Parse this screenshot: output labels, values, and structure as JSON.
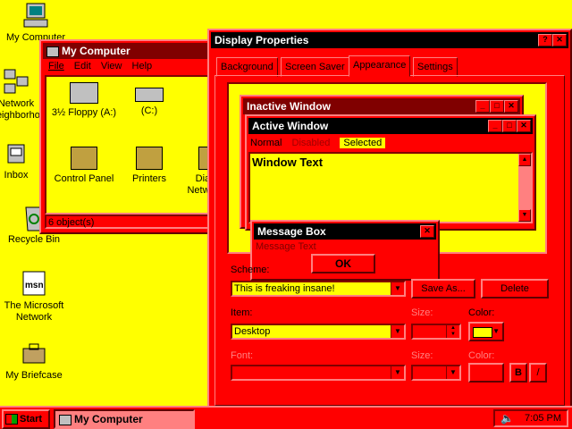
{
  "desktop": {
    "icons": [
      {
        "label": "My Computer"
      },
      {
        "label": "Network Neighborhood"
      },
      {
        "label": "Inbox"
      },
      {
        "label": "Recycle Bin"
      },
      {
        "label": "The Microsoft Network"
      },
      {
        "label": "My Briefcase"
      }
    ]
  },
  "mycomputer": {
    "title": "My Computer",
    "menu": [
      "File",
      "Edit",
      "View",
      "Help"
    ],
    "items": [
      {
        "label": "3½ Floppy (A:)",
        "icon": "floppy-drive-icon"
      },
      {
        "label": "(C:)",
        "icon": "hard-drive-icon"
      },
      {
        "label": "Control Panel",
        "icon": "control-panel-icon"
      },
      {
        "label": "Printers",
        "icon": "printers-icon"
      },
      {
        "label": "Dial-Up Networking",
        "icon": "dialup-icon"
      }
    ],
    "status": "6 object(s)"
  },
  "display": {
    "title": "Display Properties",
    "tabs": [
      "Background",
      "Screen Saver",
      "Appearance",
      "Settings"
    ],
    "active_tab": "Appearance",
    "preview": {
      "inactive_title": "Inactive Window",
      "active_title": "Active Window",
      "menu_normal": "Normal",
      "menu_disabled": "Disabled",
      "menu_selected": "Selected",
      "window_text": "Window Text",
      "msgbox_title": "Message Box",
      "msgbox_text": "Message Text",
      "msgbox_ok": "OK"
    },
    "scheme_label": "Scheme:",
    "scheme_value": "This is freaking insane!",
    "save_as": "Save As...",
    "delete": "Delete",
    "item_label": "Item:",
    "item_value": "Desktop",
    "size_label": "Size:",
    "color_label": "Color:",
    "font_label": "Font:",
    "font_size_label": "Size:",
    "font_color_label": "Color:",
    "bold_btn": "B",
    "italic_btn": "/"
  },
  "taskbar": {
    "start": "Start",
    "task": "My Computer",
    "clock": "7:05 PM"
  },
  "colors": {
    "desktop": "#ffff00",
    "window": "#ff0000",
    "title_active": "#000000",
    "title_inactive": "#800000"
  }
}
